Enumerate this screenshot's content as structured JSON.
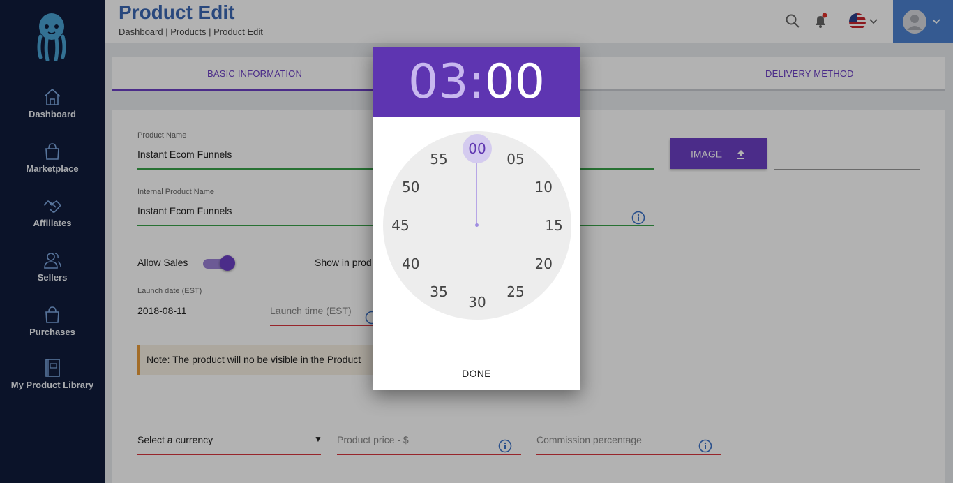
{
  "sidebar": {
    "items": [
      {
        "label": "Dashboard",
        "icon": "home-icon"
      },
      {
        "label": "Marketplace",
        "icon": "shopping-bag-icon"
      },
      {
        "label": "Affiliates",
        "icon": "handshake-icon"
      },
      {
        "label": "Sellers",
        "icon": "users-icon"
      },
      {
        "label": "Purchases",
        "icon": "shopping-bag-icon"
      },
      {
        "label": "My Product Library",
        "icon": "book-icon"
      }
    ]
  },
  "header": {
    "title": "Product Edit",
    "breadcrumb": "Dashboard | Products | Product Edit"
  },
  "tabs": [
    {
      "label": "BASIC INFORMATION",
      "active": true
    },
    {
      "label": "DELIVERY METHOD",
      "active": false
    }
  ],
  "form": {
    "product_name": {
      "label": "Product Name",
      "value": "Instant Ecom Funnels"
    },
    "internal_name": {
      "label": "Internal Product Name",
      "value": "Instant Ecom Funnels"
    },
    "image_button": "IMAGE",
    "allow_sales": {
      "label": "Allow Sales",
      "on": true
    },
    "show_in_products": {
      "label": "Show in prod"
    },
    "launch_date": {
      "label": "Launch date (EST)",
      "value": "2018-08-11"
    },
    "launch_time": {
      "placeholder": "Launch time (EST)"
    },
    "note": "Note: The product will no be visible in the Product",
    "currency": {
      "value": "Select a currency",
      "arrow": "▼"
    },
    "price": {
      "placeholder": "Product price - $"
    },
    "commission": {
      "placeholder": "Commission percentage"
    }
  },
  "time_picker": {
    "hour": "03",
    "separator": ":",
    "minute": "00",
    "clock_numbers": [
      "00",
      "05",
      "10",
      "15",
      "20",
      "25",
      "30",
      "35",
      "40",
      "45",
      "50",
      "55"
    ],
    "selected": "00",
    "done_label": "DONE"
  },
  "colors": {
    "sidebar": "#101c3c",
    "accent": "#6c3fc4",
    "picker_header": "#5e35b1",
    "title_blue": "#3c68b4",
    "valid_line": "#3aa34a",
    "error_line": "#d9363e"
  }
}
